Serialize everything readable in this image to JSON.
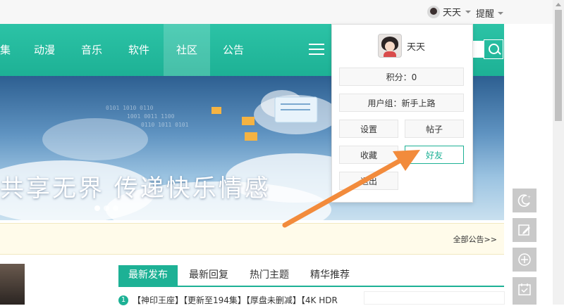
{
  "topbar": {
    "username": "天天",
    "remind_label": "提醒"
  },
  "nav": {
    "items": [
      "集",
      "动漫",
      "音乐",
      "软件",
      "社区",
      "公告"
    ],
    "active": "社区"
  },
  "banner": {
    "slogan": "共享无界  传递快乐情感"
  },
  "notice": {
    "all_link": "全部公告>>"
  },
  "tabs": [
    "最新发布",
    "最新回复",
    "热门主题",
    "精华推荐"
  ],
  "posts": [
    {
      "number": "1",
      "title": "【神印王座】【更新至194集】【厚盘未删减】【4K HDR"
    }
  ],
  "side_box_text": "   ",
  "dropdown": {
    "name": "天天",
    "points": "积分：0",
    "user_group": "用户组：新手上路",
    "settings": "设置",
    "posts": "帖子",
    "favorites": "收藏",
    "friends": "好友",
    "logout": "退出"
  },
  "colors": {
    "brand": "#1db195",
    "notice_bg": "#fffbea",
    "annotation_arrow": "#f28b3c"
  },
  "icons": [
    "moon-icon",
    "edit-icon",
    "plus-circle-icon",
    "calendar-icon",
    "search-icon",
    "menu-icon"
  ]
}
